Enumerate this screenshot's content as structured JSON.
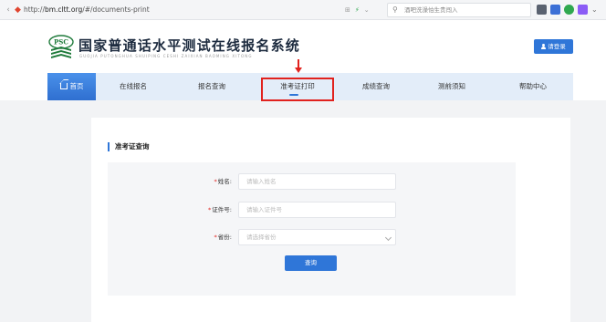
{
  "browser": {
    "url_prefix": "http://",
    "url_domain": "bm.cltt.org",
    "url_path": "/#/documents-print",
    "search_placeholder": "酒吧洗澡怕生贵闯入",
    "tools": [
      "⊞",
      "⚡",
      "⌄"
    ]
  },
  "header": {
    "logo_badge_text": "PSC",
    "title": "国家普通话水平测试在线报名系统",
    "subtitle": "GUOJIA PUTONGHUA SHUIPING CESHI ZAIXIAN BAOMING XITONG",
    "login_label": "请登录"
  },
  "nav": {
    "items": [
      {
        "label": "首页",
        "active": true
      },
      {
        "label": "在线报名"
      },
      {
        "label": "报名查询"
      },
      {
        "label": "准考证打印",
        "highlighted": true
      },
      {
        "label": "成绩查询"
      },
      {
        "label": "测前须知"
      },
      {
        "label": "帮助中心"
      }
    ]
  },
  "form": {
    "section_title": "准考证查询",
    "fields": [
      {
        "label": "姓名:",
        "placeholder": "请输入姓名"
      },
      {
        "label": "证件号:",
        "placeholder": "请输入证件号"
      },
      {
        "label": "省份:",
        "placeholder": "请选择省份"
      }
    ],
    "required_mark": "*",
    "submit_label": "查询"
  },
  "colors": {
    "accent": "#2f76d8",
    "annotation_red": "#e1221e",
    "nav_bg": "#e3edf9"
  }
}
